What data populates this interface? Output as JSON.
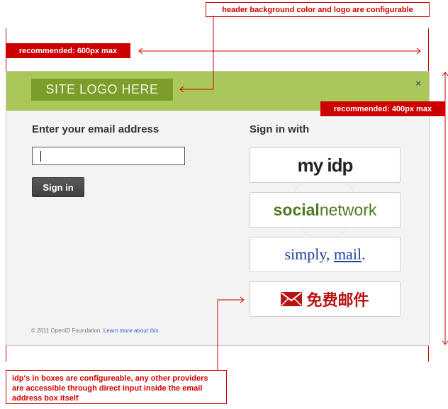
{
  "annotations": {
    "header_note": "header background color and logo are configurable",
    "width_note": "recommended: 600px max",
    "height_note": "recommended: 400px max",
    "idp_note": "idp's in boxes are configureable, any other providers are accessible through direct input inside the email address box itself"
  },
  "dialog": {
    "header": {
      "logo_text": "SITE LOGO HERE",
      "close_glyph": "×",
      "background": "#aac85a",
      "logo_background": "#7b9d2a"
    },
    "email": {
      "heading": "Enter your email address",
      "value": "",
      "placeholder": ""
    },
    "signin_button": "Sign in",
    "providers": {
      "heading": "Sign in with",
      "items": [
        {
          "text": "my idp"
        },
        {
          "text_a": "social",
          "text_b": "network"
        },
        {
          "text_a": "simply, ",
          "text_b": "mail",
          "text_c": "."
        },
        {
          "icon": "mail-envelope-icon",
          "text": "免费邮件"
        }
      ]
    },
    "footer": {
      "text": "© 2011 OpenID Foundation. ",
      "link": "Learn more about this"
    }
  },
  "colors": {
    "annotation_red": "#cc0000",
    "dialog_bg": "#f3f3f3"
  }
}
